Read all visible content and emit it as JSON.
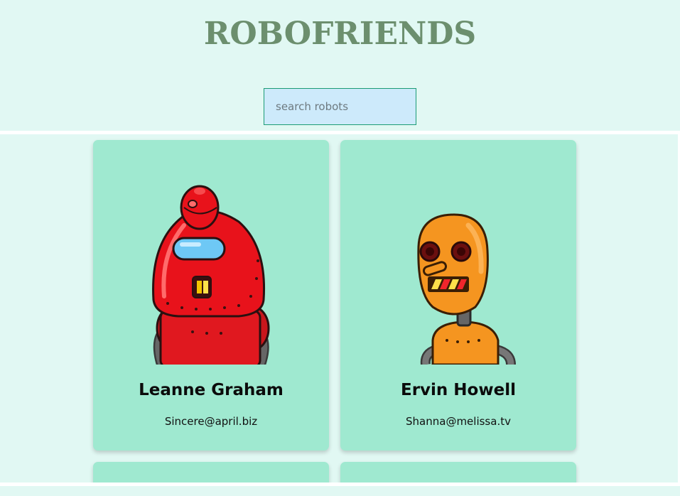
{
  "header": {
    "title": "ROBOFRIENDS"
  },
  "search": {
    "placeholder": "search robots",
    "value": ""
  },
  "robots": [
    {
      "name": "Leanne Graham",
      "email": "Sincere@april.biz",
      "image_icon": "red-robot-icon"
    },
    {
      "name": "Ervin Howell",
      "email": "Shanna@melissa.tv",
      "image_icon": "orange-robot-icon"
    }
  ],
  "colors": {
    "background": "#e1f8f3",
    "card": "#9fe9d0",
    "title": "#6c8f6e",
    "search_bg": "#cdeafb",
    "search_border": "#1b9c75"
  }
}
